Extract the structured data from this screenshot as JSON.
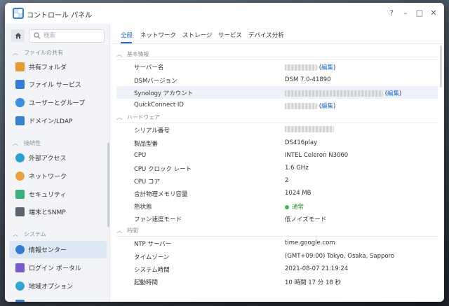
{
  "window": {
    "title": "コントロール パネル",
    "help": "?",
    "minimize": "–",
    "maximize": "□",
    "close": "✕"
  },
  "sidebar": {
    "search_placeholder": "検索",
    "sections": [
      {
        "label": "ファイルの共有",
        "items": [
          {
            "label": "共有フォルダ",
            "icon": "shared-folder-icon",
            "color": "#e89a2c"
          },
          {
            "label": "ファイル サービス",
            "icon": "file-services-icon",
            "color": "#2f7fd8"
          },
          {
            "label": "ユーザーとグループ",
            "icon": "users-groups-icon",
            "color": "#3a8fe0"
          },
          {
            "label": "ドメイン/LDAP",
            "icon": "domain-ldap-icon",
            "color": "#3a7fd4"
          }
        ]
      },
      {
        "label": "接続性",
        "items": [
          {
            "label": "外部アクセス",
            "icon": "external-access-icon",
            "color": "#2a9fd8"
          },
          {
            "label": "ネットワーク",
            "icon": "network-icon",
            "color": "#e8a33a"
          },
          {
            "label": "セキュリティ",
            "icon": "security-icon",
            "color": "#3ab07a"
          },
          {
            "label": "端末とSNMP",
            "icon": "terminal-snmp-icon",
            "color": "#5a6470"
          }
        ]
      },
      {
        "label": "システム",
        "items": [
          {
            "label": "情報センター",
            "icon": "info-center-icon",
            "color": "#2f7fd8",
            "active": true
          },
          {
            "label": "ログイン ポータル",
            "icon": "login-portal-icon",
            "color": "#7a5ad0"
          },
          {
            "label": "地域オプション",
            "icon": "regional-options-icon",
            "color": "#2fa8d8"
          }
        ]
      }
    ]
  },
  "tabs": [
    {
      "label": "全般",
      "active": true
    },
    {
      "label": "ネットワーク"
    },
    {
      "label": "ストレージ"
    },
    {
      "label": "サービス"
    },
    {
      "label": "デバイス分析"
    }
  ],
  "groups": {
    "basic": {
      "label": "基本情報",
      "server_name": {
        "key": "サーバー名",
        "link": "編集"
      },
      "dsm_version": {
        "key": "DSMバージョン",
        "value": "DSM 7.0-41890"
      },
      "synology_account": {
        "key": "Synology アカウント",
        "link": "編集"
      },
      "quickconnect": {
        "key": "QuickConnect ID",
        "link": "編集"
      }
    },
    "hardware": {
      "label": "ハードウェア",
      "serial": {
        "key": "シリアル番号"
      },
      "model": {
        "key": "製品型番",
        "value": "DS416play"
      },
      "cpu": {
        "key": "CPU",
        "value": "INTEL Celeron N3060"
      },
      "cpu_clock": {
        "key": "CPU クロック レート",
        "value": "1.6 GHz"
      },
      "cpu_cores": {
        "key": "CPU コア",
        "value": "2"
      },
      "memory": {
        "key": "合計物理メモリ容量",
        "value": "1024 MB"
      },
      "thermal": {
        "key": "熱状態",
        "value": "通常",
        "status_color": "#3bb44a"
      },
      "fan": {
        "key": "ファン速度モード",
        "value": "低ノイズモード"
      }
    },
    "time": {
      "label": "時間",
      "ntp": {
        "key": "NTP サーバー",
        "value": "time.google.com"
      },
      "timezone": {
        "key": "タイムゾーン",
        "value": "(GMT+09:00) Tokyo, Osaka, Sapporo"
      },
      "system_time": {
        "key": "システム時間",
        "value": "2021-08-07 21:19:24"
      },
      "uptime": {
        "key": "起動時間",
        "value": "10 時間 17 分 18 秒"
      }
    }
  }
}
